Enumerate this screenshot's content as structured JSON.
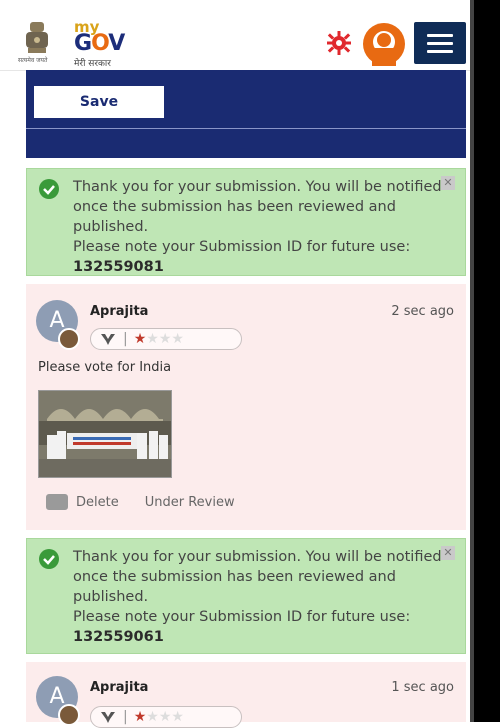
{
  "header": {
    "emblem_caption": "सत्यमेव जयते",
    "logo_my": "my",
    "logo_gov_g": "G",
    "logo_gov_o": "O",
    "logo_gov_v": "V",
    "logo_sub": "मेरी सरकार",
    "icons": [
      "gear-icon",
      "user-avatar-icon",
      "hamburger-menu-icon"
    ],
    "brand_colors": {
      "navy": "#1a2b72",
      "orange": "#e86a12",
      "gold": "#d9a31a"
    }
  },
  "form": {
    "save_label": "Save"
  },
  "submissions": [
    {
      "message": "Thank you for your submission. You will be notified once the submission has been reviewed and published.",
      "note": "Please note your Submission ID for future use:",
      "id": "132559081",
      "close": "✕"
    },
    {
      "message": "Thank you for your submission. You will be notified once the submission has been reviewed and published.",
      "note": "Please note your Submission ID for future use:",
      "id": "132559061",
      "close": "✕"
    }
  ],
  "comments": [
    {
      "avatar_letter": "A",
      "author": "Aprajita",
      "time": "2 sec ago",
      "rating_stars": 1,
      "rating_max": 4,
      "text": "Please vote for India",
      "actions": {
        "delete": "Delete",
        "status": "Under Review"
      }
    },
    {
      "avatar_letter": "A",
      "author": "Aprajita",
      "time": "1 sec ago",
      "rating_stars": 1,
      "rating_max": 4
    }
  ]
}
